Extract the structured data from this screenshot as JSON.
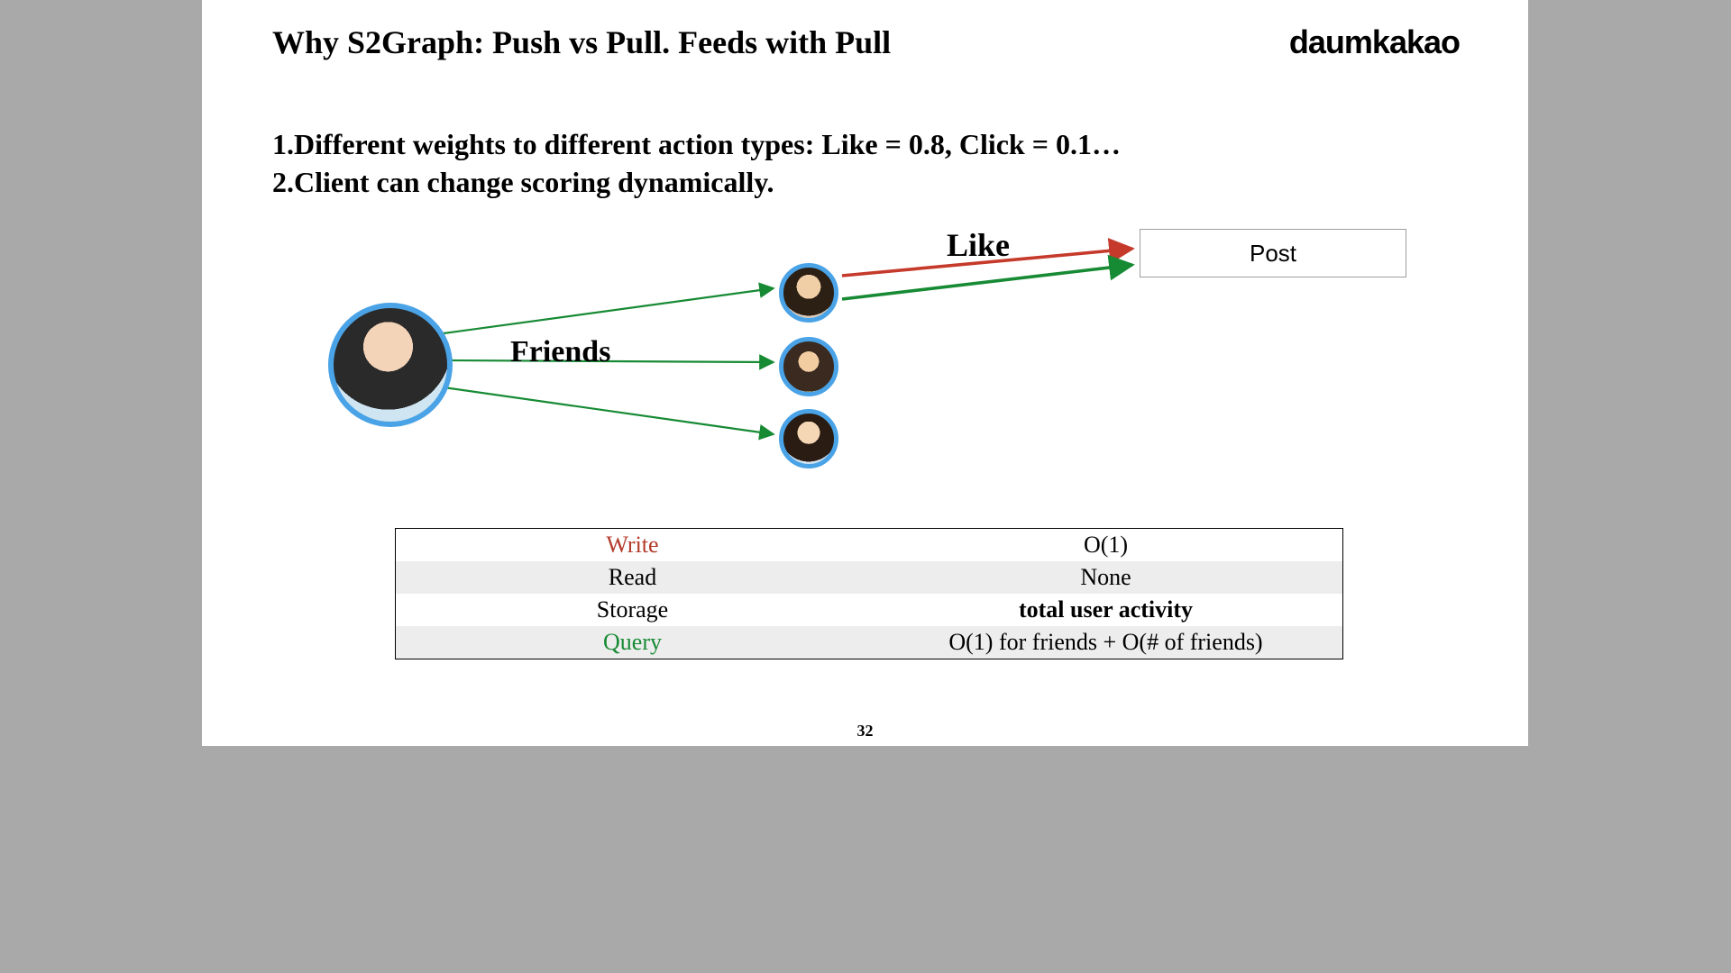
{
  "title": "Why S2Graph: Push vs Pull. Feeds with Pull",
  "brand": "daumkakao",
  "bullets": {
    "b1": "1.Different weights to different action types: Like = 0.8, Click = 0.1…",
    "b2": "2.Client can change scoring dynamically."
  },
  "diagram": {
    "friends_label": "Friends",
    "like_label": "Like",
    "post_label": "Post"
  },
  "table": {
    "rows": [
      {
        "label": "Write",
        "value": "O(1)",
        "label_class": "c-write"
      },
      {
        "label": "Read",
        "value": "None"
      },
      {
        "label": "Storage",
        "value": "total user activity",
        "value_bold": true
      },
      {
        "label": "Query",
        "value": "O(1) for friends + O(# of friends)",
        "label_class": "c-query"
      }
    ]
  },
  "page_number": "32"
}
